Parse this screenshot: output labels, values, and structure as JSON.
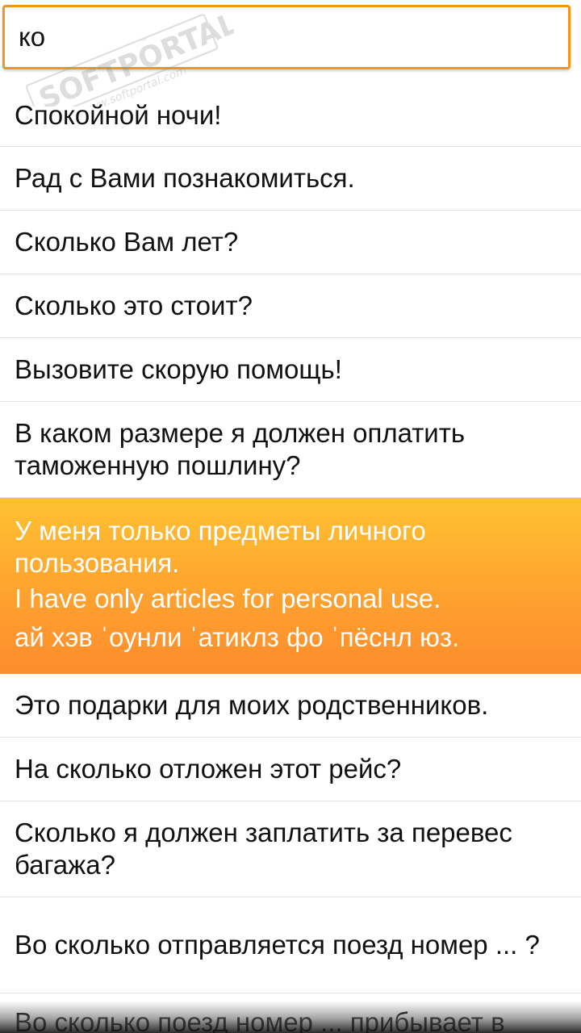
{
  "search": {
    "value": "ко"
  },
  "watermark": {
    "brand": "SOFTPORTAL",
    "url": "www.softportal.com",
    "tm": "™"
  },
  "phrases": [
    "Спокойной ночи!",
    "Рад с Вами познакомиться.",
    "Сколько Вам лет?",
    "Сколько это стоит?",
    "Вызовите скорую помощь!",
    "В каком размере я должен оплатить таможенную пошлину?",
    "У меня только предметы личного пользования.",
    "Это подарки для моих родственников.",
    "На сколько отложен этот рейс?",
    "Сколько я должен заплатить за перевес багажа?",
    "Во сколько отправляется поезд номер ... ?",
    "Во сколько поезд номер ... прибывает в"
  ],
  "selected": {
    "english": "I have only articles for personal use.",
    "transcription": "ай хэв ˈоунли ˈатиклз фо ˈпёснл юз."
  },
  "colors": {
    "accent": "#f7941d",
    "selected_top": "#fec232",
    "selected_bottom": "#fd8c2c"
  }
}
